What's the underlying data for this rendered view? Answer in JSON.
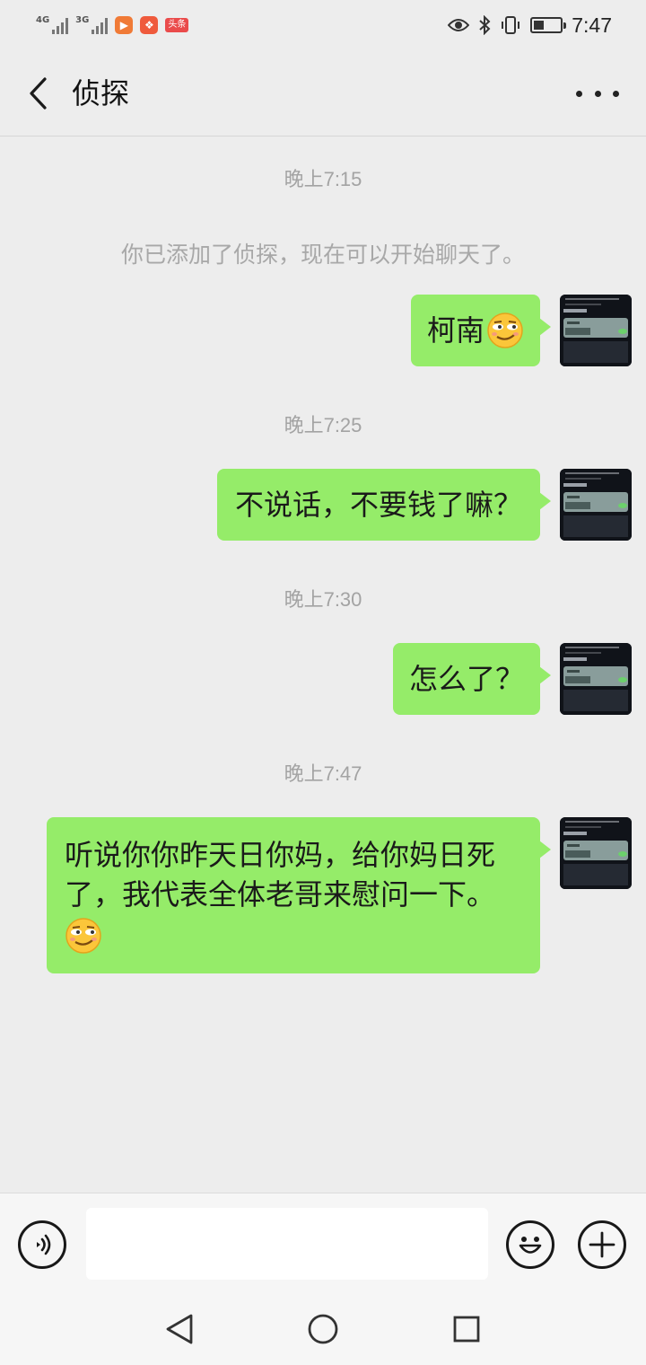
{
  "status_bar": {
    "network_1": "4G",
    "network_2": "3G",
    "toutiao_label": "头条",
    "time": "7:47",
    "battery_level": 0.4
  },
  "header": {
    "title": "侦探"
  },
  "chat": {
    "system_message": "你已添加了侦探，现在可以开始聊天了。",
    "timestamps": [
      "晚上7:15",
      "晚上7:25",
      "晚上7:30",
      "晚上7:47"
    ],
    "messages": [
      {
        "lines": [
          "柯南"
        ],
        "emoji": "smirk-emoji"
      },
      {
        "lines": [
          "不说话，不要钱了嘛？"
        ]
      },
      {
        "lines": [
          "怎么了？"
        ]
      },
      {
        "lines": [
          "听说你你昨天日你妈，给你妈日死",
          "了，我代表全体老哥来慰问一下。"
        ],
        "emoji": "smirk-emoji"
      }
    ]
  },
  "input_bar": {
    "text_value": "",
    "voice_icon": "voice-icon",
    "emoji_icon": "smile-icon",
    "plus_icon": "plus-icon"
  },
  "colors": {
    "background": "#ededed",
    "bubble": "#95ec69",
    "timestamp": "#a3a3a3"
  }
}
